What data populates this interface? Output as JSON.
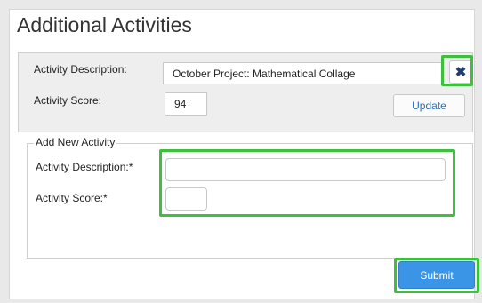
{
  "page": {
    "title": "Additional Activities"
  },
  "existing_activity": {
    "description_label": "Activity Description:",
    "description_value": "October Project: Mathematical Collage",
    "score_label": "Activity Score:",
    "score_value": "94",
    "delete_icon": "close-x-icon",
    "update_label": "Update"
  },
  "new_activity": {
    "legend": "Add New Activity",
    "description_label": "Activity Description:*",
    "description_value": "",
    "score_label": "Activity Score:*",
    "score_value": "",
    "submit_label": "Submit"
  },
  "colors": {
    "highlight": "#3dc13c",
    "submit_bg": "#3a95e7",
    "update_text": "#2a6fb8",
    "delete_icon": "#1e3d73"
  }
}
